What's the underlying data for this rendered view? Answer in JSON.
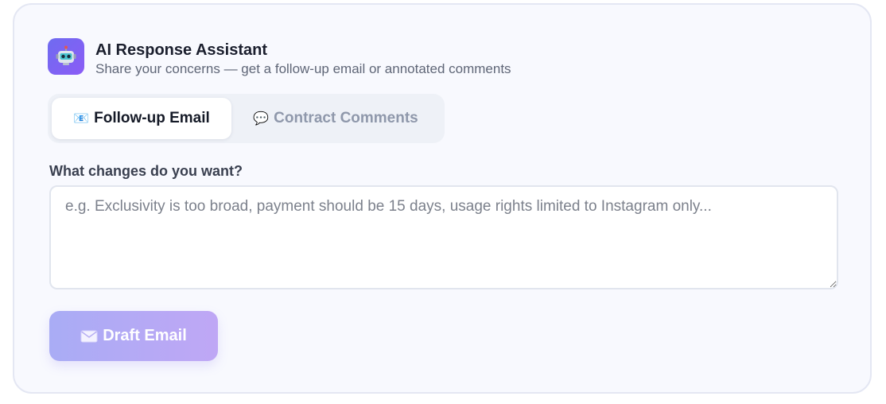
{
  "header": {
    "title": "AI Response Assistant",
    "subtitle": "Share your concerns — get a follow-up email or annotated comments",
    "icon": "robot-icon"
  },
  "tabs": [
    {
      "icon": "envelope-icon",
      "emoji": "📧",
      "label": "Follow-up Email",
      "active": true
    },
    {
      "icon": "speech-bubble-icon",
      "emoji": "💬",
      "label": "Contract Comments",
      "active": false
    }
  ],
  "form": {
    "label": "What changes do you want?",
    "value": "",
    "placeholder": "e.g. Exclusivity is too broad, payment should be 15 days, usage rights limited to Instagram only..."
  },
  "action": {
    "icon": "envelope-icon",
    "label": "Draft Email"
  },
  "colors": {
    "accent_start": "#a9acf5",
    "accent_end": "#bfa7f5",
    "icon_bg": "#7a67f3"
  }
}
